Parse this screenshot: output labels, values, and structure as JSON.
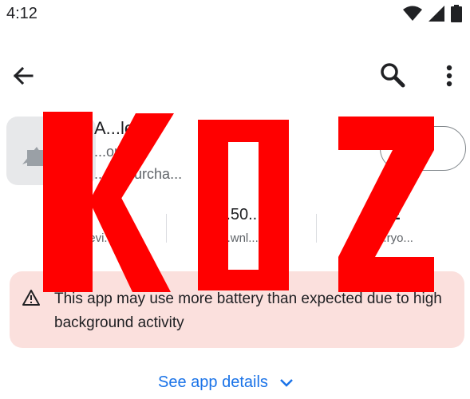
{
  "status_bar": {
    "time": "4:12"
  },
  "app": {
    "name": "A...le",
    "developer": "...oper",
    "in_app_purchases": "...pp purcha...",
    "install_label": "...ll"
  },
  "stats": [
    {
      "value": "",
      "label": "...evi...o"
    },
    {
      "value": "...50...",
      "label": "...wnl..."
    },
    {
      "value": "E",
      "label": "...ryo..."
    }
  ],
  "warning": {
    "text": "This app may use more battery than expected due to high background activity"
  },
  "see_details": {
    "label": "See app details"
  },
  "overlay": {
    "text": "KO2",
    "color": "#ff0000"
  },
  "colors": {
    "accent": "#1a73e8",
    "warning_bg": "#fbe0dd"
  }
}
